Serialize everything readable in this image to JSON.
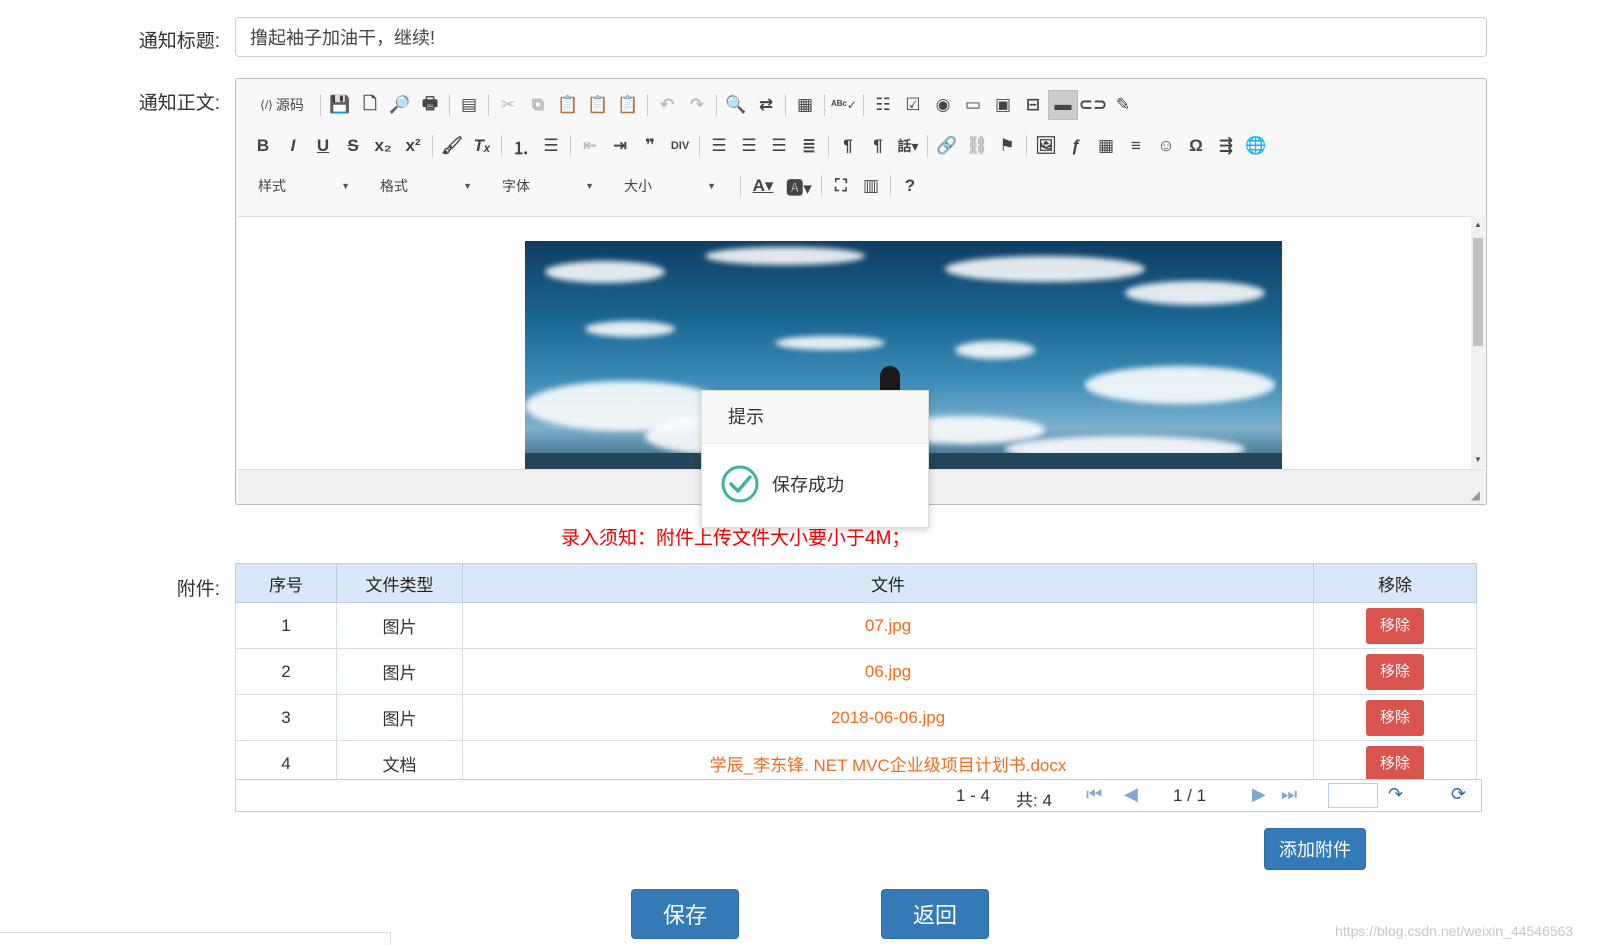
{
  "form": {
    "title_label": "通知标题:",
    "title_value": "撸起袖子加油干，继续!",
    "body_label": "通知正文:",
    "attach_label": "附件:"
  },
  "toolbar": {
    "source_label": "源码",
    "combos": [
      "样式",
      "格式",
      "字体",
      "大小"
    ],
    "row1_icons": [
      "save-icon",
      "new-page-icon",
      "preview-icon",
      "print-icon",
      "templates-icon",
      "cut-icon",
      "copy-icon",
      "paste-icon",
      "paste-text-icon",
      "paste-word-icon",
      "undo-icon",
      "redo-icon",
      "find-icon",
      "replace-icon",
      "select-all-icon",
      "spellcheck-icon",
      "form-icon",
      "checkbox-icon",
      "radio-icon",
      "textfield-icon",
      "textarea-icon",
      "select-icon",
      "button-icon",
      "imagebutton-icon",
      "hiddenfield-icon"
    ],
    "row2_icons": [
      "bold-icon",
      "italic-icon",
      "underline-icon",
      "strike-icon",
      "subscript-icon",
      "superscript-icon",
      "copy-format-icon",
      "remove-format-icon",
      "numbered-list-icon",
      "bulleted-list-icon",
      "outdent-icon",
      "indent-icon",
      "blockquote-icon",
      "creatediv-icon",
      "align-left-icon",
      "align-center-icon",
      "align-right-icon",
      "justify-icon",
      "ltr-icon",
      "rtl-icon",
      "language-icon",
      "link-icon",
      "unlink-icon",
      "anchor-icon",
      "image-icon",
      "flash-icon",
      "table-icon",
      "hr-icon",
      "smiley-icon",
      "special-char-icon",
      "pagebreak-icon",
      "iframe-icon"
    ],
    "row3_icons": [
      "text-color-icon",
      "bg-color-icon",
      "maximize-icon",
      "show-blocks-icon",
      "help-icon"
    ]
  },
  "dialog": {
    "title": "提示",
    "message": "保存成功"
  },
  "notice": "录入须知：附件上传文件大小要小于4M；",
  "table": {
    "headers": [
      "序号",
      "文件类型",
      "文件",
      "移除"
    ],
    "rows": [
      {
        "idx": "1",
        "type": "图片",
        "file": "07.jpg",
        "action": "移除"
      },
      {
        "idx": "2",
        "type": "图片",
        "file": "06.jpg",
        "action": "移除"
      },
      {
        "idx": "3",
        "type": "图片",
        "file": "2018-06-06.jpg",
        "action": "移除"
      },
      {
        "idx": "4",
        "type": "文档",
        "file": "学辰_李东锋. NET MVC企业级项目计划书.docx",
        "action": "移除"
      }
    ]
  },
  "pager": {
    "range": "1 - 4",
    "total": "共: 4",
    "page": "1 / 1",
    "input_value": ""
  },
  "buttons": {
    "add_attachment": "添加附件",
    "save": "保存",
    "back": "返回"
  },
  "watermark": "https://blog.csdn.net/weixin_44546563",
  "colors": {
    "primary": "#337ab7",
    "danger": "#d9534f",
    "notice": "#e00000",
    "file_link": "#f06c1e",
    "table_header": "#d9e8f8"
  }
}
